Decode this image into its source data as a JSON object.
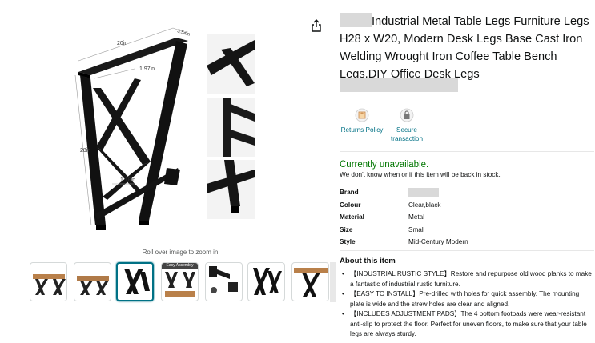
{
  "gallery": {
    "dimensions": {
      "width": "20in",
      "depth": "3.54in",
      "upper_rail": "1.97in",
      "height": "28in",
      "lower_rail": "1.18in"
    },
    "zoom_hint": "Roll over image to zoom in",
    "thumbnail_badge": "Easy Assembly",
    "active_thumbnail_index": 2
  },
  "product": {
    "title": "Industrial Metal Table Legs Furniture Legs H28 x W20, Modern Desk Legs Base Cast Iron Welding Wrought Iron Coffee Table Bench Legs,DIY Office Desk Legs",
    "share_icon": "share-icon"
  },
  "trust": [
    {
      "icon": "return-policy-icon",
      "label_lines": [
        "Returns Policy"
      ]
    },
    {
      "icon": "lock-icon",
      "label_lines": [
        "Secure",
        "transaction"
      ]
    }
  ],
  "availability": {
    "status": "Currently unavailable.",
    "note": "We don't know when or if this item will be back in stock."
  },
  "specs": [
    {
      "key": "Brand",
      "value": ""
    },
    {
      "key": "Colour",
      "value": "Clear,black"
    },
    {
      "key": "Material",
      "value": "Metal"
    },
    {
      "key": "Size",
      "value": "Small"
    },
    {
      "key": "Style",
      "value": "Mid-Century Modern"
    }
  ],
  "about": {
    "heading": "About this item",
    "bullets": [
      "【INDUSTRIAL RUSTIC STYLE】Restore and repurpose old wood planks to make a fantastic of industrial rustic furniture.",
      "【EASY TO INSTALL】Pre-drilled with holes for quick assembly. The mounting plate is wide and the strew holes are clear and aligned.",
      "【INCLUDES ADJUSTMENT PADS】The 4 bottom footpads were wear-resistant anti-slip to protect the floor. Perfect for uneven floors, to make sure that your table legs are always sturdy."
    ]
  },
  "colors": {
    "link": "#007185",
    "in_stock_green": "#007600",
    "metal": "#141414",
    "wood": "#b9804a"
  }
}
